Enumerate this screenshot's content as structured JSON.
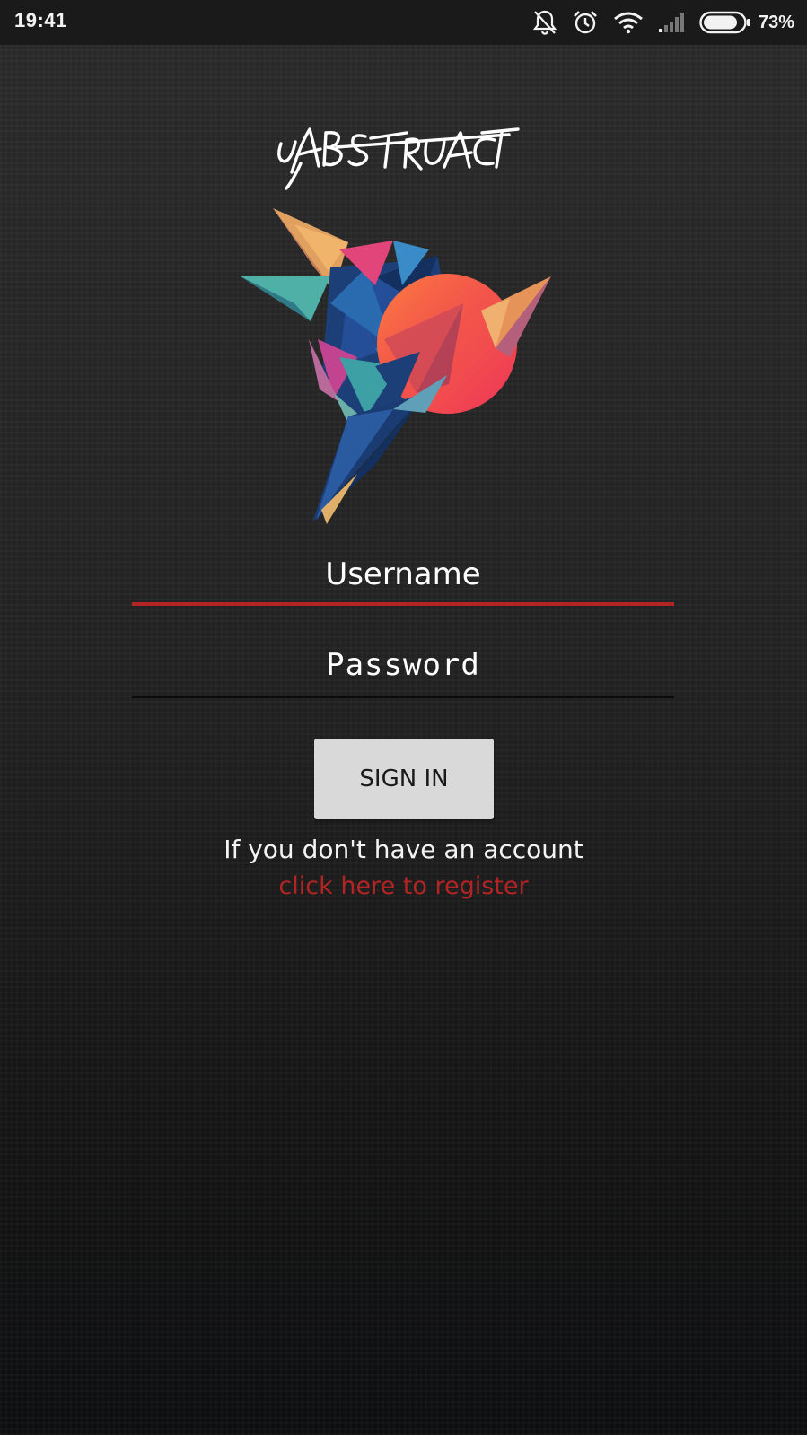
{
  "status_bar": {
    "time": "19:41",
    "battery_percent": "73%",
    "battery_level": 0.73,
    "icons": [
      "notifications-off-icon",
      "alarm-icon",
      "wifi-icon",
      "signal-icon",
      "battery-icon"
    ]
  },
  "logo": {
    "wordmark": "ABSTRACT",
    "art": "polygon-bird-icon"
  },
  "form": {
    "username_placeholder": "Username",
    "password_placeholder": "Password",
    "signin_label": "SIGN IN"
  },
  "register": {
    "prompt": "If you don't have an account",
    "link": "click here to register"
  },
  "colors": {
    "accent": "#b32424",
    "button_bg": "#d9d9d9",
    "background": "#222222"
  }
}
